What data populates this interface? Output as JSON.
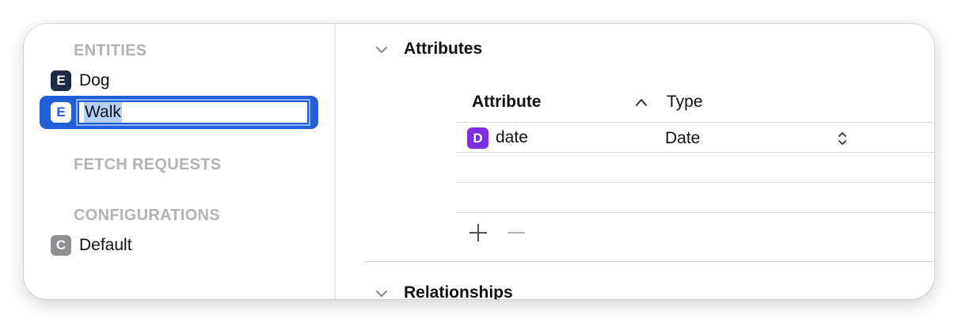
{
  "sidebar": {
    "entities_header": "ENTITIES",
    "entities": [
      {
        "badge": "E",
        "label": "Dog"
      },
      {
        "badge": "E",
        "label": "Walk"
      }
    ],
    "fetch_requests_header": "FETCH REQUESTS",
    "configurations_header": "CONFIGURATIONS",
    "configurations": [
      {
        "badge": "C",
        "label": "Default"
      }
    ]
  },
  "main": {
    "attributes_section": {
      "title": "Attributes",
      "columns": {
        "attribute": "Attribute",
        "type": "Type"
      },
      "rows": [
        {
          "badge": "D",
          "name": "date",
          "type": "Date"
        }
      ]
    },
    "relationships_section": {
      "title": "Relationships"
    }
  },
  "colors": {
    "selection": "#1f5fd9",
    "entity_badge": "#1d2b45",
    "config_badge": "#8e8e93",
    "date_badge": "#7b2fe0",
    "section_header": "#b3b3b3"
  },
  "icons": {
    "add": "plus-icon",
    "remove": "minus-icon",
    "disclosure": "chevron-down-icon",
    "sort": "sort-ascending-icon",
    "popup": "up-down-chevron-icon"
  }
}
